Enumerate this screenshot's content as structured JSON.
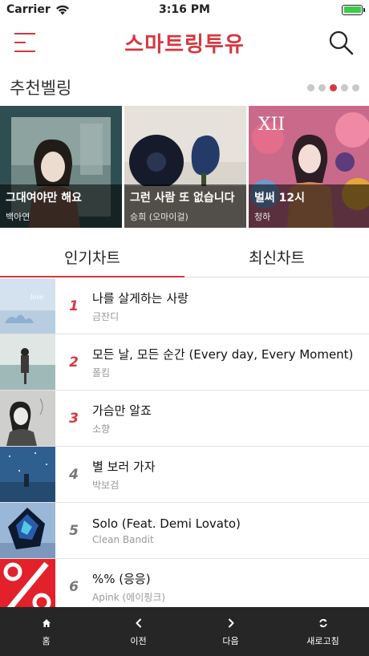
{
  "status_bar": {
    "carrier": "Carrier",
    "time": "3:16 PM",
    "battery_level": 1.0,
    "battery_color": "#3dcc4a"
  },
  "nav": {
    "title": "스마트링투유",
    "menu_icon": "hamburger-menu-icon",
    "search_icon": "search-icon",
    "accent_color": "#d7373f"
  },
  "recommended": {
    "title": "추천벨링",
    "page_count": 5,
    "active_page": 3,
    "cards": [
      {
        "title": "그대여야만 해요",
        "artist": "백아연"
      },
      {
        "title": "그런 사람 또 없습니다",
        "artist": "승희 (오마이걸)"
      },
      {
        "title": "벌써 12시",
        "artist": "청하"
      }
    ]
  },
  "tabs": [
    {
      "label": "인기차트",
      "active": true
    },
    {
      "label": "최신차트",
      "active": false
    }
  ],
  "chart": [
    {
      "rank": "1",
      "title": "나를 살게하는 사랑",
      "artist": "금잔디"
    },
    {
      "rank": "2",
      "title": "모든 날, 모든 순간 (Every day, Every Moment)",
      "artist": "폴킴"
    },
    {
      "rank": "3",
      "title": "가슴만 알죠",
      "artist": "소향"
    },
    {
      "rank": "4",
      "title": "별 보러 가자",
      "artist": "박보검"
    },
    {
      "rank": "5",
      "title": "Solo (Feat. Demi Lovato)",
      "artist": "Clean Bandit"
    },
    {
      "rank": "6",
      "title": "%% (응응)",
      "artist": "Apink (에이핑크)"
    }
  ],
  "toolbar": {
    "home_label": "홈",
    "prev_label": "이전",
    "next_label": "다음",
    "refresh_label": "새로고침"
  }
}
